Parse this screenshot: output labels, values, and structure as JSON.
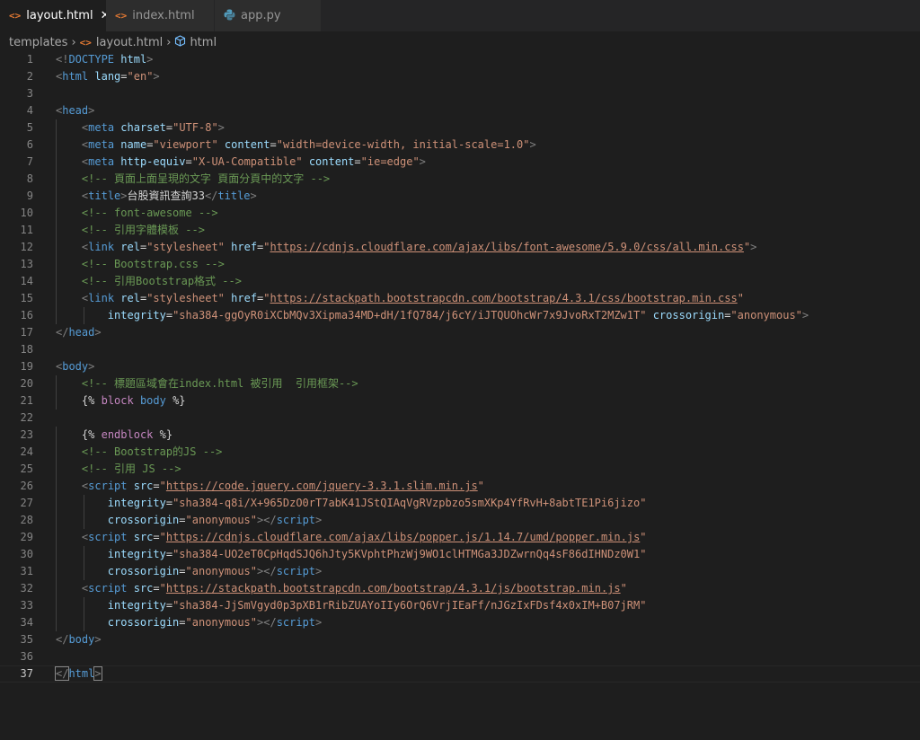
{
  "tabs": [
    {
      "icon": "<>",
      "label": "layout.html",
      "active": true,
      "close": "✕"
    },
    {
      "icon": "<>",
      "label": "index.html",
      "active": false
    },
    {
      "icon": "py",
      "label": "app.py",
      "active": false
    }
  ],
  "breadcrumb": {
    "folder": "templates",
    "file": "layout.html",
    "symbol": "html"
  },
  "editor": {
    "current_line": 37,
    "lines": [
      {
        "n": "1",
        "segments": [
          [
            "ta",
            "<!"
          ],
          [
            "t",
            "DOCTYPE"
          ],
          [
            "txt",
            " "
          ],
          [
            "at",
            "html"
          ],
          [
            "ta",
            ">"
          ]
        ]
      },
      {
        "n": "2",
        "segments": [
          [
            "ta",
            "<"
          ],
          [
            "t",
            "html"
          ],
          [
            "txt",
            " "
          ],
          [
            "at",
            "lang"
          ],
          [
            "txt",
            "="
          ],
          [
            "s",
            "\"en\""
          ],
          [
            "ta",
            ">"
          ]
        ]
      },
      {
        "n": "3",
        "segments": []
      },
      {
        "n": "4",
        "segments": [
          [
            "ta",
            "<"
          ],
          [
            "t",
            "head"
          ],
          [
            "ta",
            ">"
          ]
        ]
      },
      {
        "n": "5",
        "segments": [
          [
            "txt",
            "    "
          ],
          [
            "ta",
            "<"
          ],
          [
            "t",
            "meta"
          ],
          [
            "txt",
            " "
          ],
          [
            "at",
            "charset"
          ],
          [
            "txt",
            "="
          ],
          [
            "s",
            "\"UTF-8\""
          ],
          [
            "ta",
            ">"
          ]
        ]
      },
      {
        "n": "6",
        "segments": [
          [
            "txt",
            "    "
          ],
          [
            "ta",
            "<"
          ],
          [
            "t",
            "meta"
          ],
          [
            "txt",
            " "
          ],
          [
            "at",
            "name"
          ],
          [
            "txt",
            "="
          ],
          [
            "s",
            "\"viewport\""
          ],
          [
            "txt",
            " "
          ],
          [
            "at",
            "content"
          ],
          [
            "txt",
            "="
          ],
          [
            "s",
            "\"width=device-width, initial-scale=1.0\""
          ],
          [
            "ta",
            ">"
          ]
        ]
      },
      {
        "n": "7",
        "segments": [
          [
            "txt",
            "    "
          ],
          [
            "ta",
            "<"
          ],
          [
            "t",
            "meta"
          ],
          [
            "txt",
            " "
          ],
          [
            "at",
            "http-equiv"
          ],
          [
            "txt",
            "="
          ],
          [
            "s",
            "\"X-UA-Compatible\""
          ],
          [
            "txt",
            " "
          ],
          [
            "at",
            "content"
          ],
          [
            "txt",
            "="
          ],
          [
            "s",
            "\"ie=edge\""
          ],
          [
            "ta",
            ">"
          ]
        ]
      },
      {
        "n": "8",
        "segments": [
          [
            "txt",
            "    "
          ],
          [
            "c",
            "<!-- 頁面上面呈現的文字 頁面分頁中的文字 -->"
          ]
        ]
      },
      {
        "n": "9",
        "segments": [
          [
            "txt",
            "    "
          ],
          [
            "ta",
            "<"
          ],
          [
            "t",
            "title"
          ],
          [
            "ta",
            ">"
          ],
          [
            "txt",
            "台股資訊查詢33"
          ],
          [
            "ta",
            "</"
          ],
          [
            "t",
            "title"
          ],
          [
            "ta",
            ">"
          ]
        ]
      },
      {
        "n": "10",
        "segments": [
          [
            "txt",
            "    "
          ],
          [
            "c",
            "<!-- font-awesome -->"
          ]
        ]
      },
      {
        "n": "11",
        "segments": [
          [
            "txt",
            "    "
          ],
          [
            "c",
            "<!-- 引用字體模板 -->"
          ]
        ]
      },
      {
        "n": "12",
        "segments": [
          [
            "txt",
            "    "
          ],
          [
            "ta",
            "<"
          ],
          [
            "t",
            "link"
          ],
          [
            "txt",
            " "
          ],
          [
            "at",
            "rel"
          ],
          [
            "txt",
            "="
          ],
          [
            "s",
            "\"stylesheet\""
          ],
          [
            "txt",
            " "
          ],
          [
            "at",
            "href"
          ],
          [
            "txt",
            "="
          ],
          [
            "s",
            "\""
          ],
          [
            "u",
            "https://cdnjs.cloudflare.com/ajax/libs/font-awesome/5.9.0/css/all.min.css"
          ],
          [
            "s",
            "\""
          ],
          [
            "ta",
            ">"
          ]
        ]
      },
      {
        "n": "13",
        "segments": [
          [
            "txt",
            "    "
          ],
          [
            "c",
            "<!-- Bootstrap.css -->"
          ]
        ]
      },
      {
        "n": "14",
        "segments": [
          [
            "txt",
            "    "
          ],
          [
            "c",
            "<!-- 引用Bootstrap格式 -->"
          ]
        ]
      },
      {
        "n": "15",
        "segments": [
          [
            "txt",
            "    "
          ],
          [
            "ta",
            "<"
          ],
          [
            "t",
            "link"
          ],
          [
            "txt",
            " "
          ],
          [
            "at",
            "rel"
          ],
          [
            "txt",
            "="
          ],
          [
            "s",
            "\"stylesheet\""
          ],
          [
            "txt",
            " "
          ],
          [
            "at",
            "href"
          ],
          [
            "txt",
            "="
          ],
          [
            "s",
            "\""
          ],
          [
            "u",
            "https://stackpath.bootstrapcdn.com/bootstrap/4.3.1/css/bootstrap.min.css"
          ],
          [
            "s",
            "\""
          ]
        ]
      },
      {
        "n": "16",
        "segments": [
          [
            "txt",
            "        "
          ],
          [
            "at",
            "integrity"
          ],
          [
            "txt",
            "="
          ],
          [
            "s",
            "\"sha384-ggOyR0iXCbMQv3Xipma34MD+dH/1fQ784/j6cY/iJTQUOhcWr7x9JvoRxT2MZw1T\""
          ],
          [
            "txt",
            " "
          ],
          [
            "at",
            "crossorigin"
          ],
          [
            "txt",
            "="
          ],
          [
            "s",
            "\"anonymous\""
          ],
          [
            "ta",
            ">"
          ]
        ]
      },
      {
        "n": "17",
        "segments": [
          [
            "ta",
            "</"
          ],
          [
            "t",
            "head"
          ],
          [
            "ta",
            ">"
          ]
        ]
      },
      {
        "n": "18",
        "segments": []
      },
      {
        "n": "19",
        "segments": [
          [
            "ta",
            "<"
          ],
          [
            "t",
            "body"
          ],
          [
            "ta",
            ">"
          ]
        ]
      },
      {
        "n": "20",
        "segments": [
          [
            "txt",
            "    "
          ],
          [
            "c",
            "<!-- 標題區域會在index.html 被引用  引用框架-->"
          ]
        ]
      },
      {
        "n": "21",
        "segments": [
          [
            "txt",
            "    "
          ],
          [
            "txt",
            "{% "
          ],
          [
            "j",
            "block"
          ],
          [
            "txt",
            " "
          ],
          [
            "t",
            "body"
          ],
          [
            "txt",
            " %}"
          ]
        ]
      },
      {
        "n": "22",
        "segments": []
      },
      {
        "n": "23",
        "segments": [
          [
            "txt",
            "    "
          ],
          [
            "txt",
            "{% "
          ],
          [
            "j",
            "endblock"
          ],
          [
            "txt",
            " %}"
          ]
        ]
      },
      {
        "n": "24",
        "segments": [
          [
            "txt",
            "    "
          ],
          [
            "c",
            "<!-- Bootstrap的JS -->"
          ]
        ]
      },
      {
        "n": "25",
        "segments": [
          [
            "txt",
            "    "
          ],
          [
            "c",
            "<!-- 引用 JS -->"
          ]
        ]
      },
      {
        "n": "26",
        "segments": [
          [
            "txt",
            "    "
          ],
          [
            "ta",
            "<"
          ],
          [
            "t",
            "script"
          ],
          [
            "txt",
            " "
          ],
          [
            "at",
            "src"
          ],
          [
            "txt",
            "="
          ],
          [
            "s",
            "\""
          ],
          [
            "u",
            "https://code.jquery.com/jquery-3.3.1.slim.min.js"
          ],
          [
            "s",
            "\""
          ]
        ]
      },
      {
        "n": "27",
        "segments": [
          [
            "txt",
            "        "
          ],
          [
            "at",
            "integrity"
          ],
          [
            "txt",
            "="
          ],
          [
            "s",
            "\"sha384-q8i/X+965DzO0rT7abK41JStQIAqVgRVzpbzo5smXKp4YfRvH+8abtTE1Pi6jizo\""
          ]
        ]
      },
      {
        "n": "28",
        "segments": [
          [
            "txt",
            "        "
          ],
          [
            "at",
            "crossorigin"
          ],
          [
            "txt",
            "="
          ],
          [
            "s",
            "\"anonymous\""
          ],
          [
            "ta",
            "></"
          ],
          [
            "t",
            "script"
          ],
          [
            "ta",
            ">"
          ]
        ]
      },
      {
        "n": "29",
        "segments": [
          [
            "txt",
            "    "
          ],
          [
            "ta",
            "<"
          ],
          [
            "t",
            "script"
          ],
          [
            "txt",
            " "
          ],
          [
            "at",
            "src"
          ],
          [
            "txt",
            "="
          ],
          [
            "s",
            "\""
          ],
          [
            "u",
            "https://cdnjs.cloudflare.com/ajax/libs/popper.js/1.14.7/umd/popper.min.js"
          ],
          [
            "s",
            "\""
          ]
        ]
      },
      {
        "n": "30",
        "segments": [
          [
            "txt",
            "        "
          ],
          [
            "at",
            "integrity"
          ],
          [
            "txt",
            "="
          ],
          [
            "s",
            "\"sha384-UO2eT0CpHqdSJQ6hJty5KVphtPhzWj9WO1clHTMGa3JDZwrnQq4sF86dIHNDz0W1\""
          ]
        ]
      },
      {
        "n": "31",
        "segments": [
          [
            "txt",
            "        "
          ],
          [
            "at",
            "crossorigin"
          ],
          [
            "txt",
            "="
          ],
          [
            "s",
            "\"anonymous\""
          ],
          [
            "ta",
            "></"
          ],
          [
            "t",
            "script"
          ],
          [
            "ta",
            ">"
          ]
        ]
      },
      {
        "n": "32",
        "segments": [
          [
            "txt",
            "    "
          ],
          [
            "ta",
            "<"
          ],
          [
            "t",
            "script"
          ],
          [
            "txt",
            " "
          ],
          [
            "at",
            "src"
          ],
          [
            "txt",
            "="
          ],
          [
            "s",
            "\""
          ],
          [
            "u",
            "https://stackpath.bootstrapcdn.com/bootstrap/4.3.1/js/bootstrap.min.js"
          ],
          [
            "s",
            "\""
          ]
        ]
      },
      {
        "n": "33",
        "segments": [
          [
            "txt",
            "        "
          ],
          [
            "at",
            "integrity"
          ],
          [
            "txt",
            "="
          ],
          [
            "s",
            "\"sha384-JjSmVgyd0p3pXB1rRibZUAYoIIy6OrQ6VrjIEaFf/nJGzIxFDsf4x0xIM+B07jRM\""
          ]
        ]
      },
      {
        "n": "34",
        "segments": [
          [
            "txt",
            "        "
          ],
          [
            "at",
            "crossorigin"
          ],
          [
            "txt",
            "="
          ],
          [
            "s",
            "\"anonymous\""
          ],
          [
            "ta",
            "></"
          ],
          [
            "t",
            "script"
          ],
          [
            "ta",
            ">"
          ]
        ]
      },
      {
        "n": "35",
        "segments": [
          [
            "ta",
            "</"
          ],
          [
            "t",
            "body"
          ],
          [
            "ta",
            ">"
          ]
        ]
      },
      {
        "n": "36",
        "segments": []
      },
      {
        "n": "37",
        "segments": [
          [
            "ta",
            "</"
          ],
          [
            "t",
            "html"
          ],
          [
            "ta",
            ">"
          ]
        ]
      }
    ]
  }
}
